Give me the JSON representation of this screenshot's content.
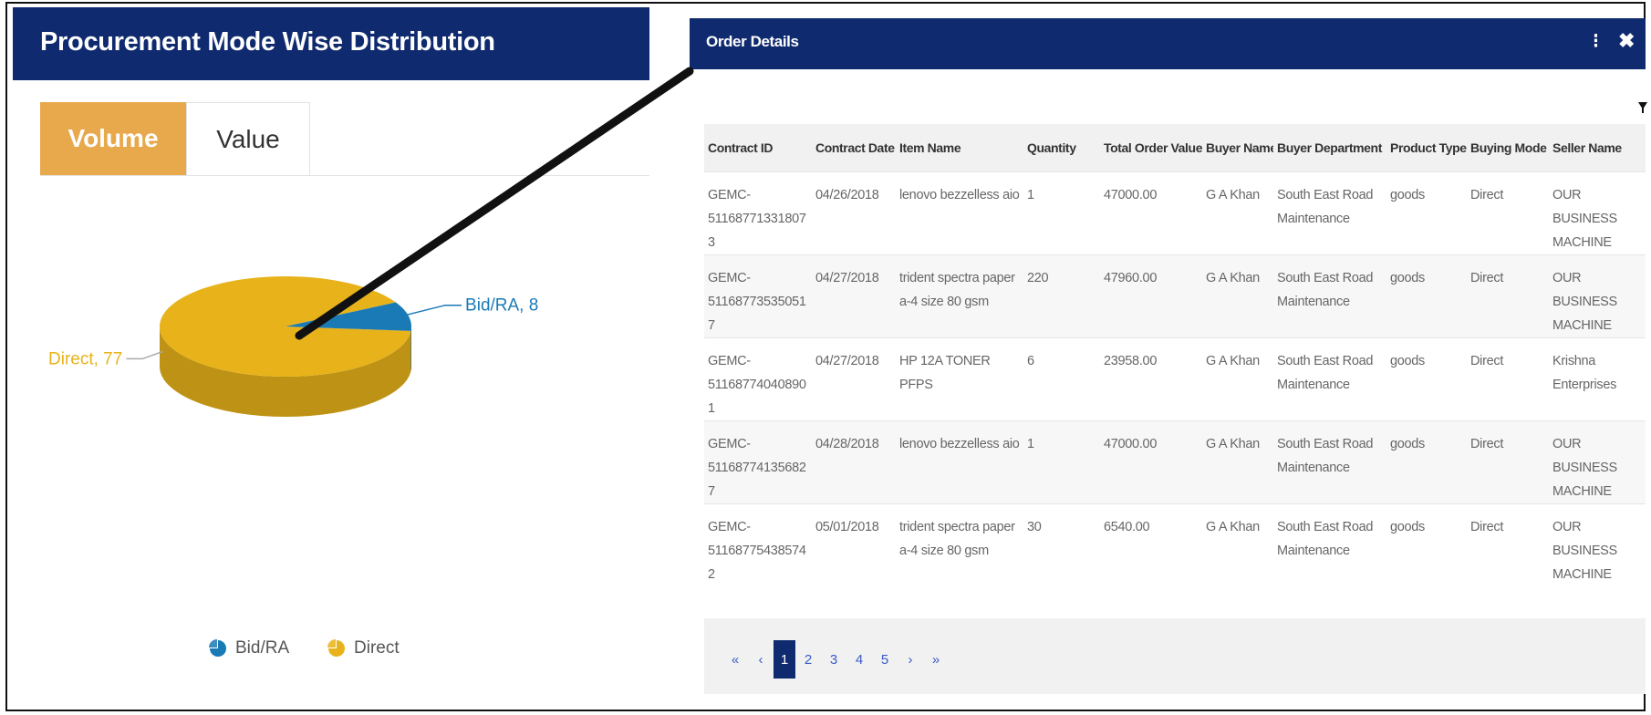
{
  "left_panel": {
    "title": "Procurement Mode Wise Distribution",
    "tabs": [
      {
        "label": "Volume",
        "active": true
      },
      {
        "label": "Value",
        "active": false
      }
    ],
    "legend": [
      {
        "label": "Bid/RA",
        "color": "#1a7ab6",
        "icon": "pie-chart-icon"
      },
      {
        "label": "Direct",
        "color": "#e8b31a",
        "icon": "pie-chart-icon"
      }
    ]
  },
  "chart_data": {
    "type": "pie",
    "slices": [
      {
        "label": "Bid/RA",
        "value": 8,
        "color": "#1a7ab6",
        "data_label": "Bid/RA, 8"
      },
      {
        "label": "Direct",
        "value": 77,
        "color": "#e8b31a",
        "data_label": "Direct, 77"
      }
    ],
    "legend": "bottom-center"
  },
  "modal": {
    "title": "Order Details",
    "menu_icon": "⁝",
    "close_icon": "✖",
    "columns": [
      "Contract ID",
      "Contract Date",
      "Item Name",
      "Quantity",
      "Total Order Value",
      "Buyer Name",
      "Buyer Department",
      "Product Type",
      "Buying Mode",
      "Seller Name"
    ],
    "rows": [
      [
        "GEMC-511687713318073",
        "04/26/2018",
        "lenovo bezzelless aio",
        "1",
        "47000.00",
        "G A Khan",
        "South East Road Maintenance",
        "goods",
        "Direct",
        "OUR BUSINESS MACHINE"
      ],
      [
        "GEMC-511687735350517",
        "04/27/2018",
        "trident spectra paper a-4 size 80 gsm",
        "220",
        "47960.00",
        "G A Khan",
        "South East Road Maintenance",
        "goods",
        "Direct",
        "OUR BUSINESS MACHINE"
      ],
      [
        "GEMC-511687740408901",
        "04/27/2018",
        "HP 12A TONER PFPS",
        "6",
        "23958.00",
        "G A Khan",
        "South East Road Maintenance",
        "goods",
        "Direct",
        "Krishna Enterprises"
      ],
      [
        "GEMC-511687741356827",
        "04/28/2018",
        "lenovo bezzelless aio",
        "1",
        "47000.00",
        "G A Khan",
        "South East Road Maintenance",
        "goods",
        "Direct",
        "OUR BUSINESS MACHINE"
      ],
      [
        "GEMC-511687754385742",
        "05/01/2018",
        "trident spectra paper a-4 size 80 gsm",
        "30",
        "6540.00",
        "G A Khan",
        "South East Road Maintenance",
        "goods",
        "Direct",
        "OUR BUSINESS MACHINE"
      ]
    ],
    "pagination": {
      "first": "«",
      "prev": "‹",
      "pages": [
        "1",
        "2",
        "3",
        "4",
        "5"
      ],
      "current": "1",
      "next": "›",
      "last": "»"
    }
  },
  "colors": {
    "header_bg": "#0f2a6e",
    "active_tab": "#e8a84c",
    "bid_ra": "#1a7ab6",
    "direct": "#e8b31a"
  }
}
